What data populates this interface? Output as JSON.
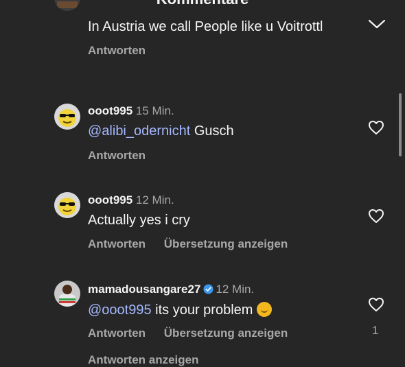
{
  "header": {
    "title": "Kommentare"
  },
  "comments": [
    {
      "username": "",
      "time": "",
      "text_mention": "",
      "text": "In Austria we call People like u Voitrottl",
      "actions": [
        "Antworten"
      ]
    },
    {
      "username": "ooot995",
      "time": "15 Min.",
      "text_mention": "@alibi_odernicht",
      "text": " Gusch",
      "actions": [
        "Antworten"
      ]
    },
    {
      "username": "ooot995",
      "time": "12 Min.",
      "text_mention": "",
      "text": "Actually yes i cry",
      "actions": [
        "Antworten",
        "Übersetzung anzeigen"
      ]
    },
    {
      "username": "mamadousangare27",
      "time": "12 Min.",
      "text_mention": "@ooot995",
      "text": " its your problem",
      "actions": [
        "Antworten",
        "Übersetzung anzeigen"
      ],
      "likes": "1"
    }
  ],
  "more_replies": "Antworten anzeigen",
  "colors": {
    "background": "#262626",
    "mention": "#a4b8ff",
    "secondary": "#a8a8a8",
    "verified": "#3897f0"
  },
  "icons": [
    "heart-icon",
    "chevron-down-icon",
    "verified-badge-icon",
    "emoji-icon"
  ]
}
